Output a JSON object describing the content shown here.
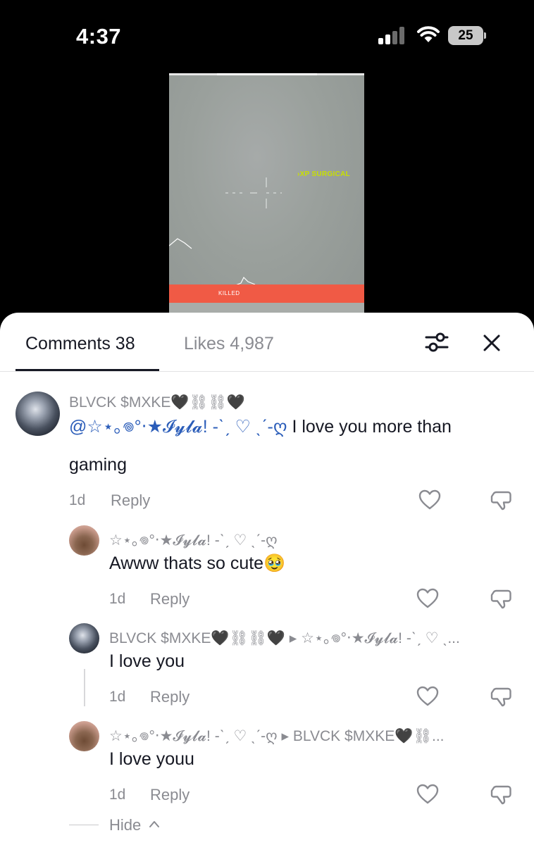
{
  "status_bar": {
    "time": "4:37",
    "battery": "25",
    "icons": [
      "signal-icon",
      "wifi-icon",
      "battery-icon"
    ]
  },
  "video": {
    "hud_text": "›XP  SURGICAL",
    "banner_text": "KILLED"
  },
  "sheet": {
    "tabs": [
      {
        "label": "Comments 38",
        "active": true
      },
      {
        "label": "Likes 4,987",
        "active": false
      }
    ],
    "icons": [
      "filter-icon",
      "close-icon"
    ]
  },
  "comments": [
    {
      "username": "BLVCK $MXKE🖤⛓⛓🖤",
      "mention": "@☆⋆｡𖦹°‧★𝓘𝔂𝓵𝓪! -ˋˏ ♡ ˎˊ-ღ",
      "text_line1": " I love you more than",
      "text_line2": "gaming",
      "time": "1d",
      "reply_label": "Reply"
    },
    {
      "username": "☆⋆｡𖦹°‧★𝓘𝔂𝓵𝓪! -ˋˏ ♡ ˎˊ-ღ",
      "text": "Awww thats so cute🥹",
      "time": "1d",
      "reply_label": "Reply"
    },
    {
      "username": "BLVCK $MXKE🖤⛓⛓🖤 ▸ ☆⋆｡𖦹°‧★𝓘𝔂𝓵𝓪! -ˋˏ ♡ ˎ...",
      "text": "I love you",
      "time": "1d",
      "reply_label": "Reply"
    },
    {
      "username": "☆⋆｡𖦹°‧★𝓘𝔂𝓵𝓪! -ˋˏ ♡ ˎˊ-ღ ▸ BLVCK $MXKE🖤⛓...",
      "text": "I love youu",
      "time": "1d",
      "reply_label": "Reply"
    }
  ],
  "hide_label": "Hide",
  "colors": {
    "text_primary": "#161823",
    "text_secondary": "#8a8b91",
    "mention": "#2b5db9",
    "killed_banner": "#f05a45",
    "hud": "#c9e000"
  }
}
